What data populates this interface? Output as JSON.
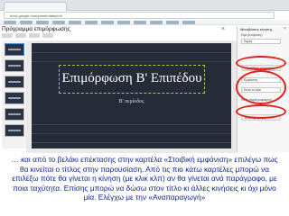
{
  "browser": {
    "url": "docs.google.com/presentation/d/",
    "bookmark_count": 12
  },
  "dialog": {
    "title": "Πρόγραμμα επιμόρφωσης",
    "close_label": "×"
  },
  "slide": {
    "title": "Επιμόρφωση Β' Επιπέδου",
    "subtitle": "Β' περίοδος"
  },
  "panel": {
    "title": "Μεταβάσεις κίνησης",
    "close_label": "×",
    "transition_header": "Εφέ μετάβασης",
    "transition_select": "Καμία",
    "add_animation_button": "Προσθήκη κίνησης",
    "effect_select": "Εμφάνιση",
    "trigger_select": "Κατά το κλικ",
    "by_paragraph_label": "Κατά παράγραφο",
    "speed_label": "Αργή",
    "play_button": "Αναπαραγωγή"
  },
  "caption": {
    "text": "… και από το βελάκι επέκτασης στην καρτέλα «Στοιβική εμφάνιση» επιλέγω πως θα κινείται ο τίτλος στην παρουσίαση. Από τις πιο κάτω καρτέλες μπορώ να επιλέξω πότε θα γίνεται η κίνηση (με κλικ κλπ) αν θα γίνεται ανά παράγραφο, με ποια ταχύτητα. Επίσης μπορώ να δώσω στον τίτλο κι άλλες κινήσεις κι όχι μόνο μία. Ελέγχω με την «Αναπαραγωγή»"
  },
  "colors": {
    "annotation_ring": "#e0221a",
    "caption_text": "#0b1f8f",
    "slide_bg": "#252c37",
    "title_box_border": "#9ecb4c"
  }
}
